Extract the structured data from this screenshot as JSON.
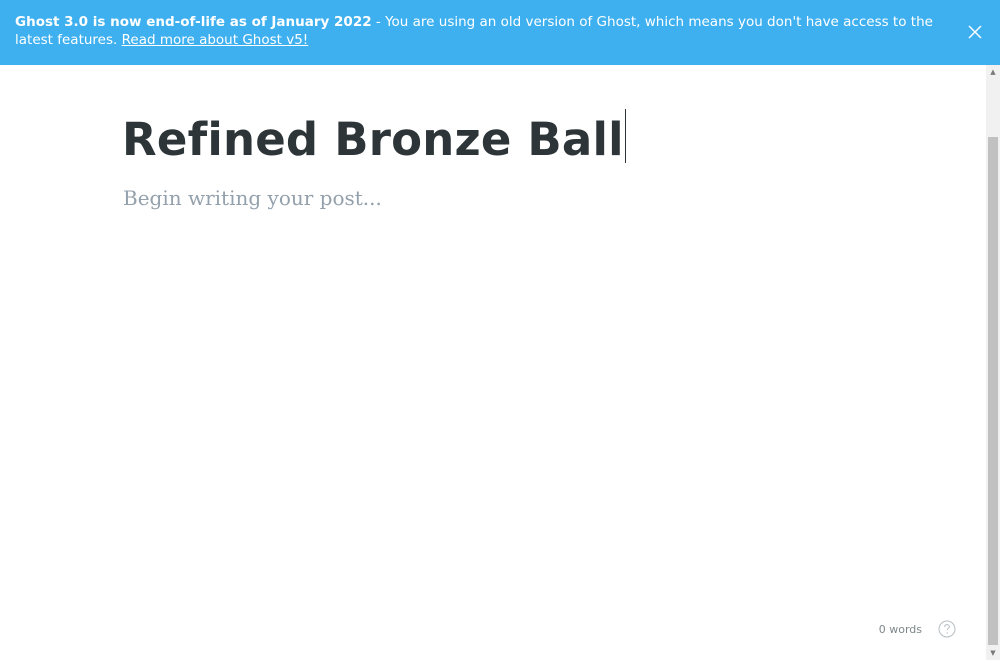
{
  "banner": {
    "bold_text": "Ghost 3.0 is now end-of-life as of January 2022",
    "text": " - You are using an old version of Ghost, which means you don't have access to the latest features. ",
    "link_label": "Read more about Ghost v5!",
    "close_icon": "close-icon",
    "background": "#3eb0ef"
  },
  "editor": {
    "title": "Refined Bronze Ball",
    "body_placeholder": "Begin writing your post...",
    "word_count": "0 words",
    "help_icon": "question-mark-circle-icon"
  },
  "scrollbar": {
    "up_arrow": "▲",
    "down_arrow": "▼"
  }
}
